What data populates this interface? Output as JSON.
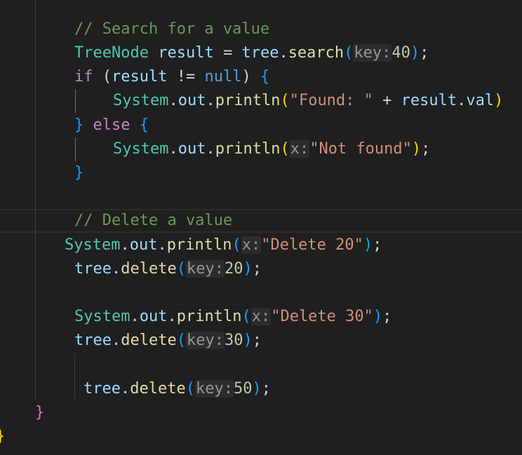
{
  "editor": {
    "lines": [
      {
        "comment": "// Search for a value"
      },
      {
        "type": "TreeNode",
        "var1": "result",
        "op1": " = ",
        "obj": "tree",
        "dot": ".",
        "func": "search",
        "hint": "key:",
        "num": "40",
        "end": ";"
      },
      {
        "kw": "if",
        "var1": "result",
        "op1": " != ",
        "kw2": "null",
        "close": ")",
        "brace": "{"
      },
      {
        "obj": "System",
        "dot1": ".",
        "field": "out",
        "dot2": ".",
        "func": "println",
        "str": "\"Found: \"",
        "op": " + ",
        "var1": "result",
        "dot3": ".",
        "field2": "val",
        "close": ")"
      },
      {
        "brace1": "}",
        "kw": "else",
        "brace2": "{"
      },
      {
        "obj": "System",
        "dot1": ".",
        "field": "out",
        "dot2": ".",
        "func": "println",
        "hint": "x:",
        "str": "\"Not found\"",
        "end": ";"
      },
      {
        "brace": "}"
      },
      {
        "comment": "// Delete a value"
      },
      {
        "obj": "System",
        "dot1": ".",
        "field": "out",
        "dot2": ".",
        "func": "println",
        "hint": "x:",
        "str": "\"Delete 20\"",
        "end": ";"
      },
      {
        "obj": "tree",
        "dot": ".",
        "func": "delete",
        "hint": "key:",
        "num": "20",
        "end": ";"
      },
      {
        "obj": "System",
        "dot1": ".",
        "field": "out",
        "dot2": ".",
        "func": "println",
        "hint": "x:",
        "str": "\"Delete 30\"",
        "end": ";"
      },
      {
        "obj": "tree",
        "dot": ".",
        "func": "delete",
        "hint": "key:",
        "num": "30",
        "end": ";"
      },
      {
        "obj": "tree",
        "dot": ".",
        "func": "delete",
        "hint": "key:",
        "num": "50",
        "end": ";"
      },
      {
        "brace": "}"
      },
      {
        "brace": "}"
      }
    ]
  },
  "colors": {
    "background": "#1f1f1f",
    "comment": "#6a9955",
    "type": "#4ec9b0",
    "variable": "#9cdcfe",
    "function": "#dcdcaa",
    "keyword": "#c586c0",
    "keyword_blue": "#569cd6",
    "number": "#b5cea8",
    "string": "#ce9178",
    "bracket_gold": "#ffd700",
    "bracket_orchid": "#da70d6",
    "bracket_blue": "#179fff"
  }
}
